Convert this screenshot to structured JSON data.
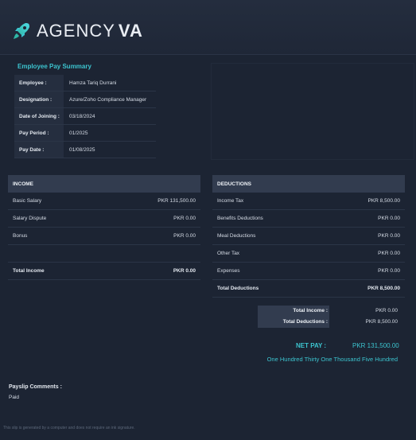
{
  "brand": {
    "name_light": "AGENCY",
    "name_bold": "VA",
    "accent": "#3cc4cf"
  },
  "summary": {
    "title": "Employee Pay Summary",
    "rows": [
      {
        "label": "Employee :",
        "value": "Hamza Tariq Durrani"
      },
      {
        "label": "Designation :",
        "value": "Azure/Zoho Compliance Manager"
      },
      {
        "label": "Date of Joining :",
        "value": "03/18/2024"
      },
      {
        "label": "Pay Period :",
        "value": "01/2025"
      },
      {
        "label": "Pay Date :",
        "value": "01/08/2025"
      }
    ]
  },
  "income": {
    "header": "INCOME",
    "rows": [
      {
        "label": "Basic Salary",
        "amount": "PKR 131,500.00"
      },
      {
        "label": "Salary Dispute",
        "amount": "PKR 0.00"
      },
      {
        "label": "Bonus",
        "amount": "PKR 0.00"
      }
    ],
    "total_label": "Total Income",
    "total_amount": "PKR 0.00"
  },
  "deductions": {
    "header": "DEDUCTIONS",
    "rows": [
      {
        "label": "Income Tax",
        "amount": "PKR 8,500.00"
      },
      {
        "label": "Benefits Deductions",
        "amount": "PKR 0.00"
      },
      {
        "label": "Meal Deductions",
        "amount": "PKR 0.00"
      },
      {
        "label": "Other Tax",
        "amount": "PKR 0.00"
      },
      {
        "label": "Expenses",
        "amount": "PKR 0.00"
      }
    ],
    "total_label": "Total Deductions",
    "total_amount": "PKR 8,500.00"
  },
  "totals": {
    "income_label": "Total Income :",
    "income_value": "PKR 0.00",
    "deductions_label": "Total Deductions :",
    "deductions_value": "PKR 8,500.00"
  },
  "net_pay": {
    "label": "NET PAY :",
    "value": "PKR 131,500.00",
    "words": "One Hundred Thirty One Thousand Five Hundred"
  },
  "comments": {
    "title": "Payslip Comments :",
    "value": "Paid"
  },
  "footer": "This slip is generated by a computer and does not require an ink signature."
}
